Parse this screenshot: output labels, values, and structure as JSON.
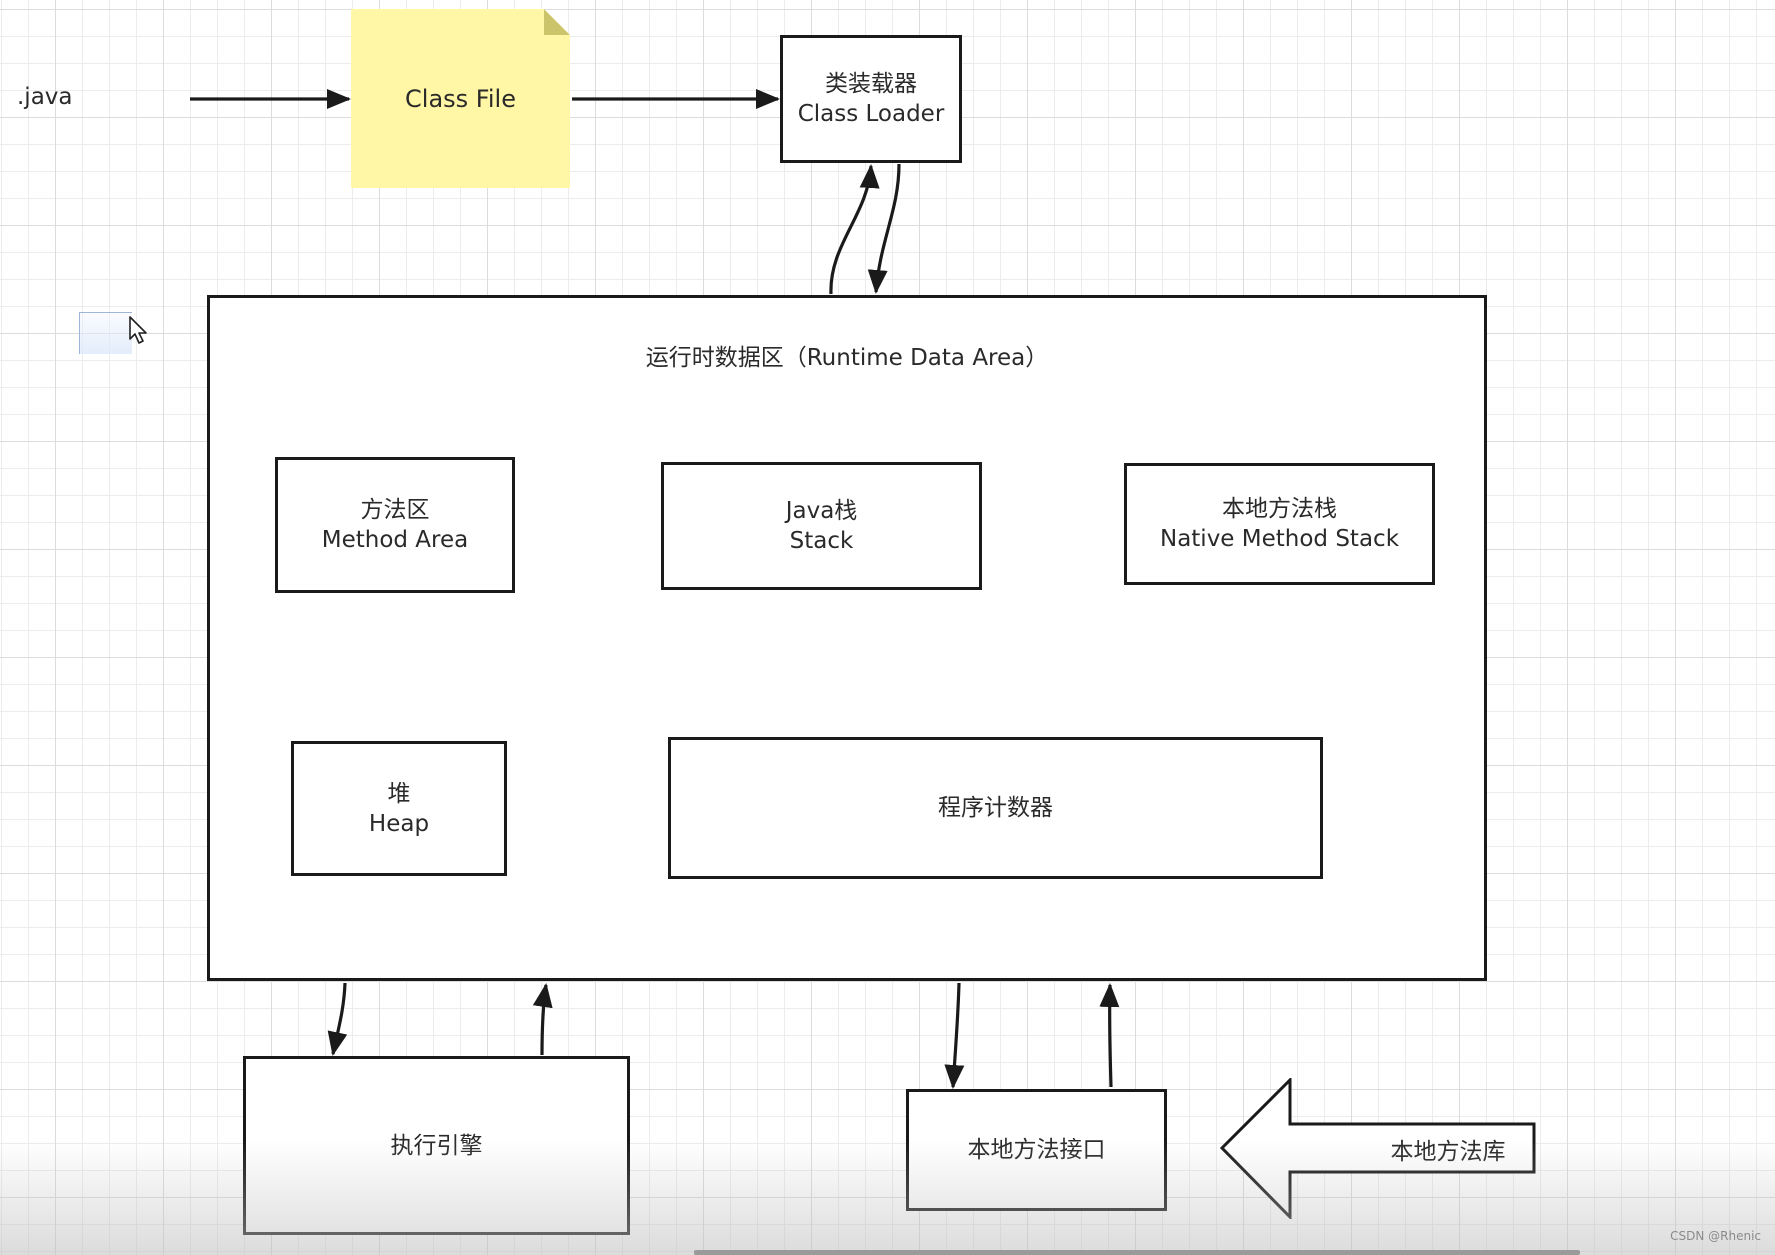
{
  "source": {
    "label": ".java"
  },
  "class_file": {
    "label": "Class File",
    "fill": "#fff7a6",
    "fold": "#cbc46a"
  },
  "class_loader": {
    "line1": "类装载器",
    "line2": "Class Loader"
  },
  "runtime_area": {
    "title": "运行时数据区（Runtime Data Area）",
    "method_area": {
      "line1": "方法区",
      "line2": "Method Area"
    },
    "java_stack": {
      "line1": "Java栈",
      "line2": "Stack"
    },
    "native_method_stack": {
      "line1": "本地方法栈",
      "line2": "Native Method Stack"
    },
    "heap": {
      "line1": "堆",
      "line2": "Heap"
    },
    "program_counter": {
      "line1": "程序计数器"
    }
  },
  "execution_engine": {
    "label": "执行引擎"
  },
  "native_interface": {
    "label": "本地方法接口"
  },
  "native_library": {
    "label": "本地方法库"
  },
  "connections": [
    {
      "from": ".java",
      "to": "Class File",
      "direction": "right"
    },
    {
      "from": "Class File",
      "to": "Class Loader",
      "direction": "right"
    },
    {
      "from": "Runtime Data Area",
      "to": "Class Loader",
      "direction": "up"
    },
    {
      "from": "Class Loader",
      "to": "Runtime Data Area",
      "direction": "down"
    },
    {
      "from": "Runtime Data Area",
      "to": "执行引擎",
      "direction": "down"
    },
    {
      "from": "执行引擎",
      "to": "Runtime Data Area",
      "direction": "up"
    },
    {
      "from": "Runtime Data Area",
      "to": "本地方法接口",
      "direction": "down"
    },
    {
      "from": "本地方法接口",
      "to": "Runtime Data Area",
      "direction": "up"
    },
    {
      "from": "本地方法库",
      "to": "本地方法接口",
      "direction": "left"
    }
  ],
  "watermark": "CSDN @Rhenic",
  "colors": {
    "stroke": "#1a1a1a",
    "note": "#fff7a6",
    "grid": "#e6e6e6"
  }
}
